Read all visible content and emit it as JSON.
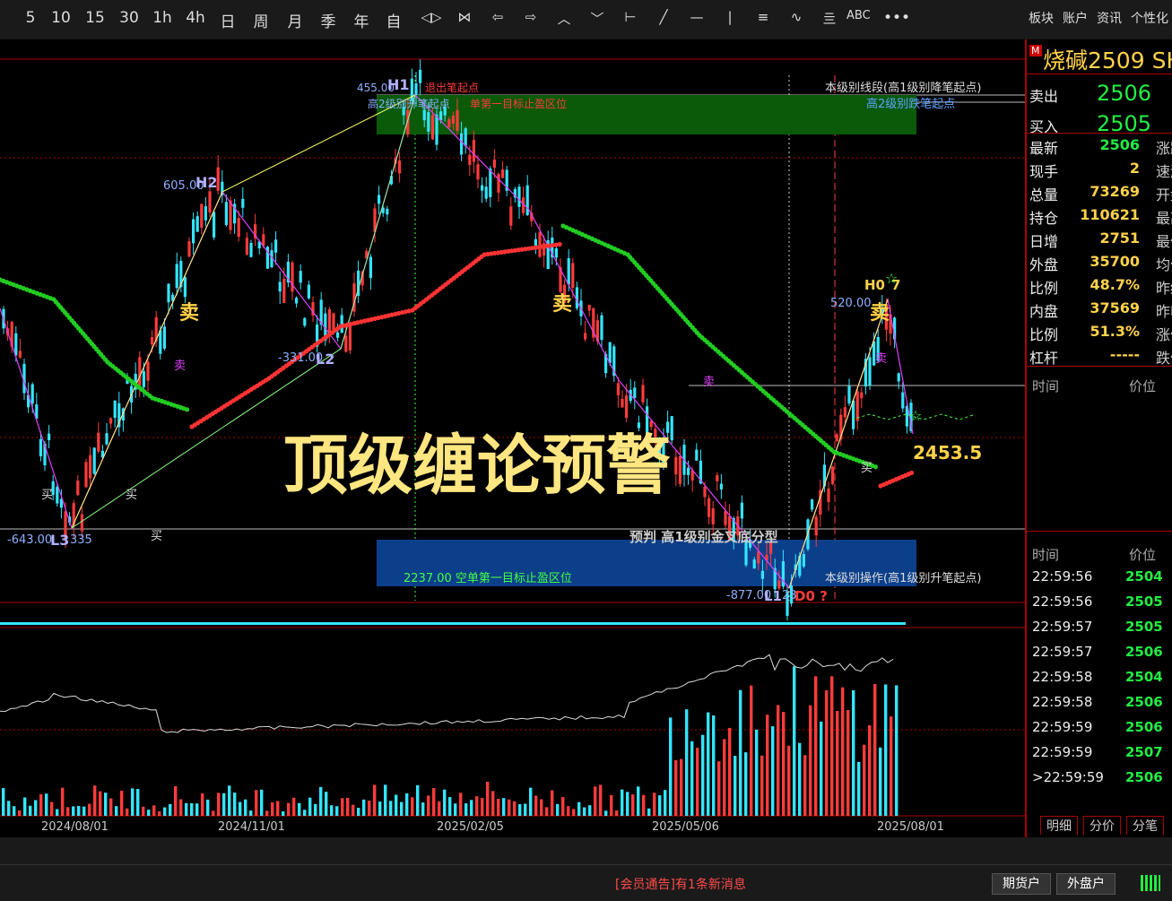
{
  "toolbar": {
    "items": [
      "5",
      "10",
      "15",
      "30",
      "1h",
      "4h",
      "日",
      "周",
      "月",
      "季",
      "年",
      "自"
    ],
    "right_menu": [
      "板块",
      "账户",
      "资讯",
      "个性化"
    ],
    "tool_text": "ABC"
  },
  "instrument": {
    "title": "烧碱2509",
    "title_tail": "SH",
    "ask_label": "卖出",
    "ask_price": "2506",
    "bid_label": "买入",
    "bid_price": "2505"
  },
  "quote": [
    {
      "label": "最新",
      "value": "2506",
      "color": "#22ee44",
      "tail": "涨跌"
    },
    {
      "label": "现手",
      "value": "2",
      "color": "#ffd24a",
      "tail": "速涨"
    },
    {
      "label": "总量",
      "value": "73269",
      "color": "#ffd24a",
      "tail": "开盘"
    },
    {
      "label": "持仓",
      "value": "110621",
      "color": "#ffd24a",
      "tail": "最高"
    },
    {
      "label": "日增",
      "value": "2751",
      "color": "#ffd24a",
      "tail": "最低"
    },
    {
      "label": "外盘",
      "value": "35700",
      "color": "#ffd24a",
      "tail": "均价"
    },
    {
      "label": "比例",
      "value": "48.7%",
      "color": "#ffd24a",
      "tail": "昨结"
    },
    {
      "label": "内盘",
      "value": "37569",
      "color": "#ffd24a",
      "tail": "昨收"
    },
    {
      "label": "比例",
      "value": "51.3%",
      "color": "#ffd24a",
      "tail": "涨停"
    },
    {
      "label": "杠杆",
      "value": "-----",
      "color": "#ffd24a",
      "tail": "跌停"
    }
  ],
  "ticks_header": {
    "time": "时间",
    "price": "价位"
  },
  "ticks": [
    {
      "time": "22:59:56",
      "price": "2504"
    },
    {
      "time": "22:59:56",
      "price": "2505"
    },
    {
      "time": "22:59:57",
      "price": "2505"
    },
    {
      "time": "22:59:57",
      "price": "2506"
    },
    {
      "time": "22:59:58",
      "price": "2504"
    },
    {
      "time": "22:59:58",
      "price": "2506"
    },
    {
      "time": "22:59:59",
      "price": "2506"
    },
    {
      "time": "22:59:59",
      "price": "2507"
    },
    {
      "time": ">22:59:59",
      "price": "2506"
    }
  ],
  "side_tabs": [
    "明细",
    "分价",
    "分笔"
  ],
  "chart": {
    "overlay_title": "顶级缠论预警",
    "x_labels": [
      "2024/08/01",
      "2024/11/01",
      "2025/02/05",
      "2025/05/06",
      "2025/08/01"
    ],
    "price_label": "2453.5",
    "ann": {
      "h1": "455.00",
      "h1_tag": "H1",
      "h1_note": "退出笔起点",
      "h1_note2": "高2级别升笔起点",
      "h1_target": "单第一目标止盈区位",
      "h2": "605.00",
      "h2_tag": "H2",
      "l2": "-331.00",
      "l2_tag": "L2",
      "l3": "-643.00",
      "l3_tag": "L3",
      "l3_val": "335",
      "top_right": "本级别线段(高1级别降笔起点)",
      "top_right2": "高2级别跌笔起点",
      "h0": "520.00",
      "h0_tag": "H0",
      "h0_val": "7",
      "bottom_box": "2237.00 空单第一目标止盈区位",
      "predict": "预判 高1级别金叉底分型",
      "bottom_right": "本级别操作(高1级别升笔起点)",
      "l1": "-877.00",
      "l1_tag": "L1",
      "l1_val": "23",
      "d0": "D0 ?",
      "buy": "买",
      "sell": "卖"
    }
  },
  "status": {
    "notice": "[会员通告]有1条新消息",
    "btn1": "期货户",
    "btn2": "外盘户"
  },
  "colors": {
    "up": "#ff3b3b",
    "down": "#33e5ff",
    "accent": "#ffd24a",
    "green": "#22ee44"
  }
}
